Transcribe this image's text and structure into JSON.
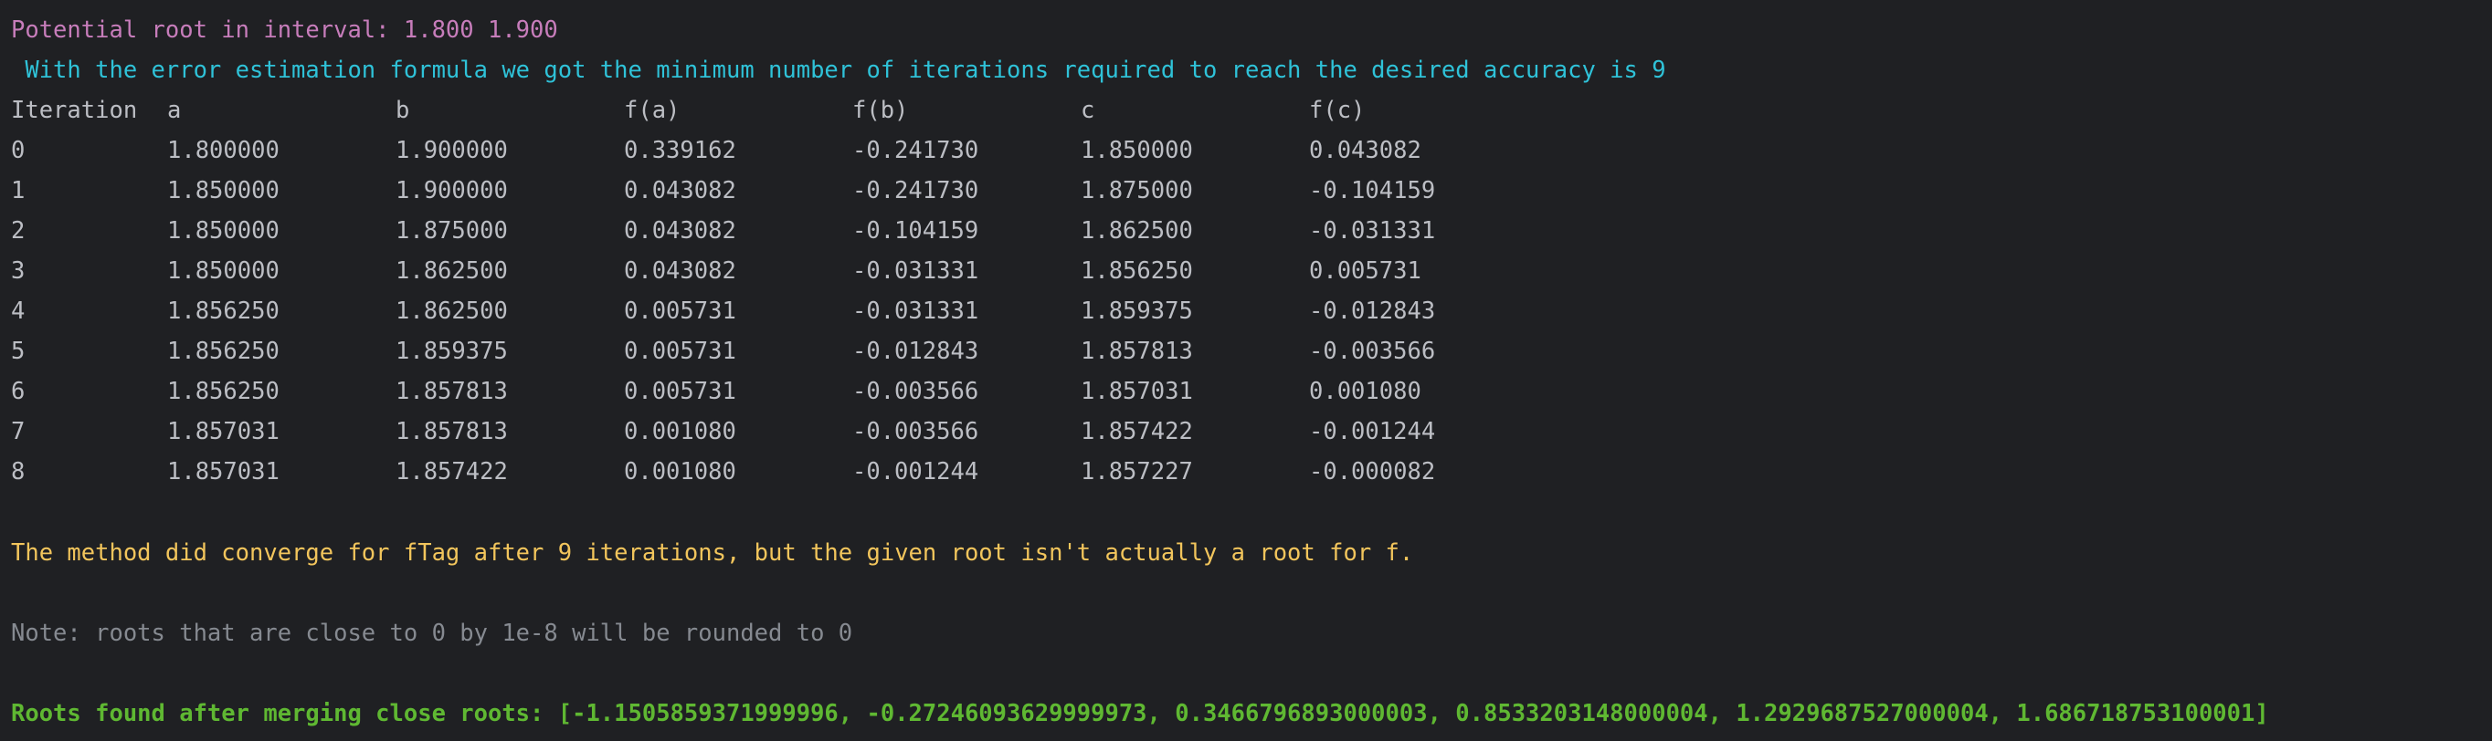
{
  "console": {
    "interval_line": "Potential root in interval: 1.800 1.900",
    "estimation_line": " With the error estimation formula we got the minimum number of iterations required to reach the desired accuracy is 9",
    "table": {
      "headers": [
        "Iteration",
        "a",
        "b",
        "f(a)",
        "f(b)",
        "c",
        "f(c)"
      ],
      "rows": [
        [
          "0",
          "1.800000",
          "1.900000",
          "0.339162",
          "-0.241730",
          "1.850000",
          "0.043082"
        ],
        [
          "1",
          "1.850000",
          "1.900000",
          "0.043082",
          "-0.241730",
          "1.875000",
          "-0.104159"
        ],
        [
          "2",
          "1.850000",
          "1.875000",
          "0.043082",
          "-0.104159",
          "1.862500",
          "-0.031331"
        ],
        [
          "3",
          "1.850000",
          "1.862500",
          "0.043082",
          "-0.031331",
          "1.856250",
          "0.005731"
        ],
        [
          "4",
          "1.856250",
          "1.862500",
          "0.005731",
          "-0.031331",
          "1.859375",
          "-0.012843"
        ],
        [
          "5",
          "1.856250",
          "1.859375",
          "0.005731",
          "-0.012843",
          "1.857813",
          "-0.003566"
        ],
        [
          "6",
          "1.856250",
          "1.857813",
          "0.005731",
          "-0.003566",
          "1.857031",
          "0.001080"
        ],
        [
          "7",
          "1.857031",
          "1.857813",
          "0.001080",
          "-0.003566",
          "1.857422",
          "-0.001244"
        ],
        [
          "8",
          "1.857031",
          "1.857422",
          "0.001080",
          "-0.001244",
          "1.857227",
          "-0.000082"
        ]
      ]
    },
    "converge_warning": "The method did converge for fTag after 9 iterations, but the given root isn't actually a root for f.",
    "note_line": "Note: roots that are close to 0 by 1e-8 will be rounded to 0",
    "roots_line": "Roots found after merging close roots: [-1.1505859371999996, -0.27246093629999973, 0.3466796893000003, 0.8533203148000004, 1.2929687527000004, 1.686718753100001]"
  },
  "colors": {
    "background": "#1f2023",
    "default_text": "#bcbec4",
    "interval_text": "#c77dbb",
    "estimation_text": "#2fc2d8",
    "warning_text": "#f2c55c",
    "note_text": "#868a91",
    "roots_text": "#5fb832"
  }
}
